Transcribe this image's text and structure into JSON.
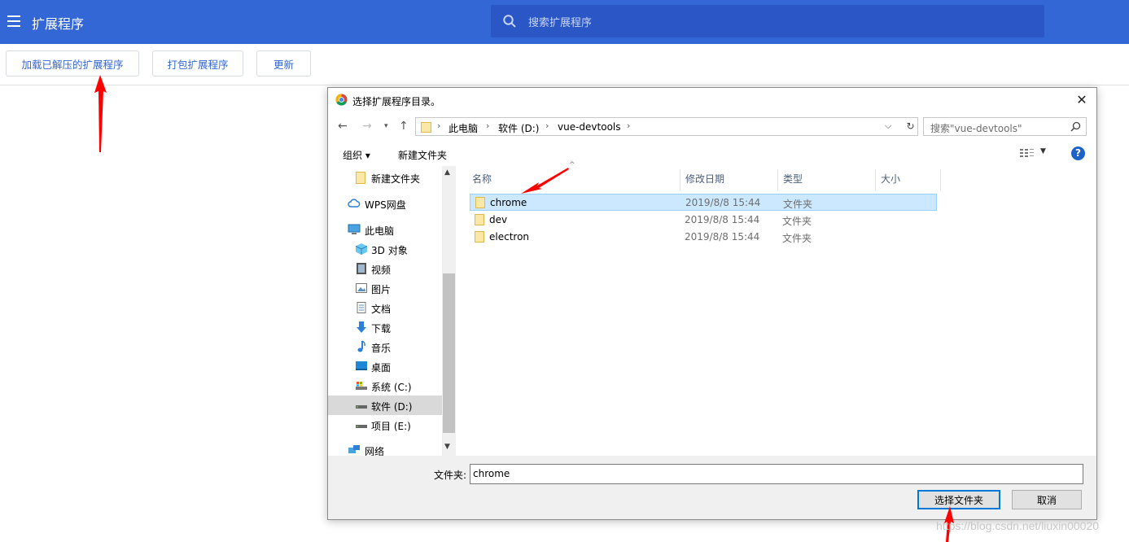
{
  "app": {
    "title": "扩展程序",
    "search_placeholder": "搜索扩展程序"
  },
  "toolbar": {
    "load_unpacked": "加载已解压的扩展程序",
    "pack": "打包扩展程序",
    "update": "更新"
  },
  "dialog": {
    "title": "选择扩展程序目录。",
    "breadcrumbs": [
      "此电脑",
      "软件 (D:)",
      "vue-devtools"
    ],
    "search_placeholder": "搜索\"vue-devtools\"",
    "commands": {
      "organize": "组织 ▾",
      "new_folder": "新建文件夹"
    },
    "nav": [
      {
        "label": "新建文件夹",
        "icon": "folder-icon"
      },
      {
        "label": "WPS网盘",
        "icon": "cloud-icon"
      },
      {
        "label": "此电脑",
        "icon": "computer-icon"
      },
      {
        "label": "3D 对象",
        "icon": "3d-objects-icon"
      },
      {
        "label": "视频",
        "icon": "video-icon"
      },
      {
        "label": "图片",
        "icon": "pictures-icon"
      },
      {
        "label": "文档",
        "icon": "documents-icon"
      },
      {
        "label": "下载",
        "icon": "download-icon"
      },
      {
        "label": "音乐",
        "icon": "music-icon"
      },
      {
        "label": "桌面",
        "icon": "desktop-icon"
      },
      {
        "label": "系统 (C:)",
        "icon": "drive-c-icon"
      },
      {
        "label": "软件 (D:)",
        "icon": "drive-d-icon",
        "selected": true
      },
      {
        "label": "项目 (E:)",
        "icon": "drive-e-icon"
      },
      {
        "label": "网络",
        "icon": "network-icon"
      }
    ],
    "columns": {
      "name": "名称",
      "modified": "修改日期",
      "type": "类型",
      "size": "大小"
    },
    "files": [
      {
        "name": "chrome",
        "modified": "2019/8/8 15:44",
        "type": "文件夹",
        "selected": true
      },
      {
        "name": "dev",
        "modified": "2019/8/8 15:44",
        "type": "文件夹"
      },
      {
        "name": "electron",
        "modified": "2019/8/8 15:44",
        "type": "文件夹"
      }
    ],
    "folder_label": "文件夹:",
    "folder_value": "chrome",
    "ok_label": "选择文件夹",
    "cancel_label": "取消"
  },
  "watermark": "https://blog.csdn.net/liuxin00020",
  "colors": {
    "header": "#3367d6",
    "search": "#2a56c6",
    "accent": "#0078d7",
    "annotation": "#ff0000"
  }
}
